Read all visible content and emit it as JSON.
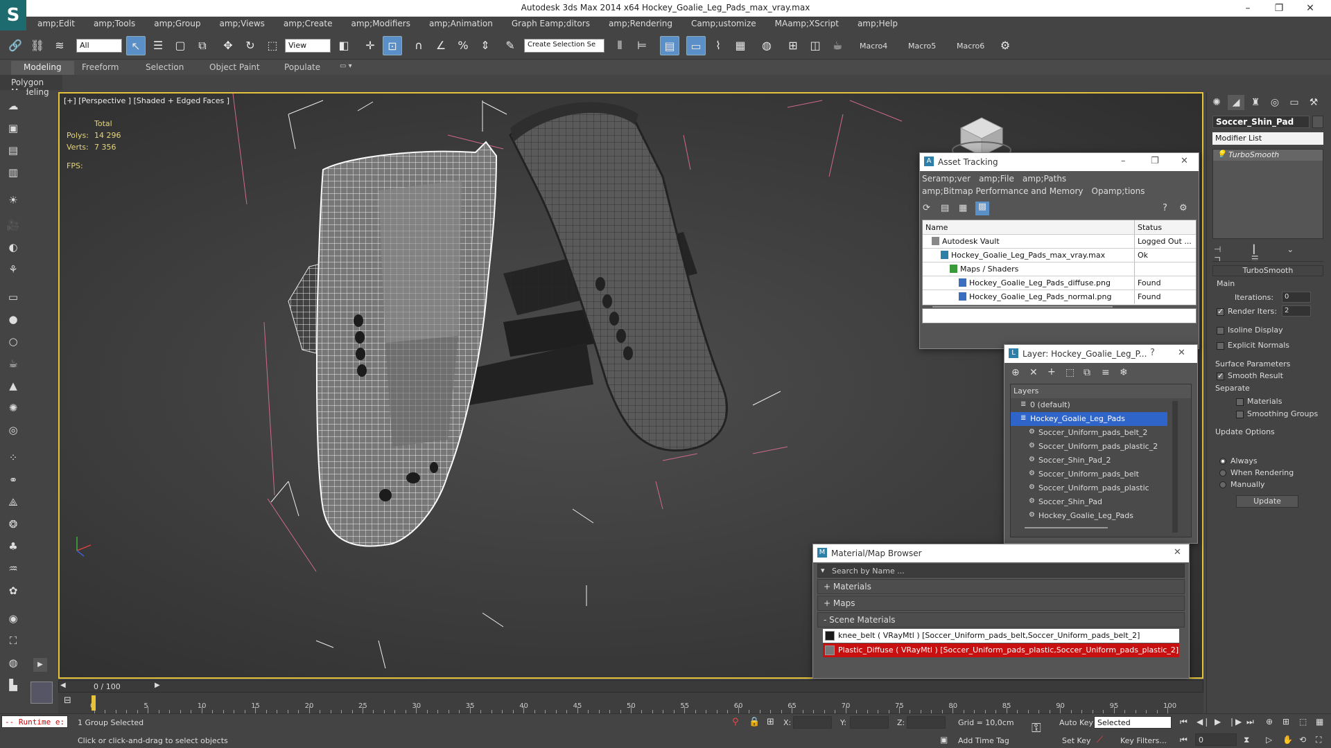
{
  "window": {
    "title": "Autodesk 3ds Max  2014 x64    Hockey_Goalie_Leg_Pads_max_vray.max",
    "controls": [
      "–",
      "❐",
      "✕"
    ]
  },
  "menu": [
    "amp;Edit",
    "amp;Tools",
    "amp;Group",
    "amp;Views",
    "amp;Create",
    "amp;Modifiers",
    "amp;Animation",
    "Graph Eamp;ditors",
    "amp;Rendering",
    "Camp;ustomize",
    "MAamp;XScript",
    "amp;Help"
  ],
  "toolbar": {
    "selection_filter": "All",
    "ref_coord": "View",
    "named_selection_placeholder": "Create Selection Se",
    "macros": [
      "Macro4",
      "Macro5",
      "Macro6"
    ]
  },
  "ribbon": {
    "tabs": [
      "Modeling",
      "Freeform",
      "Selection",
      "Object Paint",
      "Populate"
    ],
    "active_tab": "Modeling",
    "sub_label": "Polygon Modeling"
  },
  "viewport": {
    "label": "[+] [Perspective ] [Shaded + Edged Faces ]",
    "stats": {
      "total_label": "Total",
      "polys_label": "Polys:",
      "polys_value": "14 296",
      "verts_label": "Verts:",
      "verts_value": "7 356",
      "fps_label": "FPS:"
    }
  },
  "command_panel": {
    "object_name": "Soccer_Shin_Pad",
    "modifier_list": "Modifier List",
    "stack_item": "TurboSmooth",
    "rollout_title": "TurboSmooth",
    "main_label": "Main",
    "iterations_label": "Iterations:",
    "iterations_value": "0",
    "render_iters_label": "Render Iters:",
    "render_iters_value": "2",
    "render_iters_checked": true,
    "isoline_label": "Isoline Display",
    "explicit_normals_label": "Explicit Normals",
    "surface_params_label": "Surface Parameters",
    "smooth_result_label": "Smooth Result",
    "separate_label": "Separate",
    "materials_label": "Materials",
    "smoothing_groups_label": "Smoothing Groups",
    "update_options_label": "Update Options",
    "always_label": "Always",
    "when_rendering_label": "When Rendering",
    "manually_label": "Manually",
    "update_button": "Update"
  },
  "asset_tracking": {
    "title": "Asset Tracking",
    "menu1": [
      "Seramp;ver",
      "amp;File",
      "amp;Paths"
    ],
    "menu2": [
      "amp;Bitmap Performance and Memory",
      "Opamp;tions"
    ],
    "col_name": "Name",
    "col_status": "Status",
    "rows": [
      {
        "name": "Autodesk Vault",
        "status": "Logged Out ...",
        "indent": 1,
        "icon": "vault-icon"
      },
      {
        "name": "Hockey_Goalie_Leg_Pads_max_vray.max",
        "status": "Ok",
        "indent": 2,
        "icon": "max-file-icon"
      },
      {
        "name": "Maps / Shaders",
        "status": "",
        "indent": 3,
        "icon": "maps-icon"
      },
      {
        "name": "Hockey_Goalie_Leg_Pads_diffuse.png",
        "status": "Found",
        "indent": 4,
        "icon": "image-file-icon"
      },
      {
        "name": "Hockey_Goalie_Leg_Pads_normal.png",
        "status": "Found",
        "indent": 4,
        "icon": "image-file-icon"
      }
    ]
  },
  "layer_window": {
    "title": "Layer: Hockey_Goalie_Leg_P...",
    "help": "?",
    "header": "Layers",
    "rows": [
      {
        "name": "0 (default)",
        "indent": 1,
        "selected": false
      },
      {
        "name": "Hockey_Goalie_Leg_Pads",
        "indent": 1,
        "selected": true
      },
      {
        "name": "Soccer_Uniform_pads_belt_2",
        "indent": 2,
        "selected": false
      },
      {
        "name": "Soccer_Uniform_pads_plastic_2",
        "indent": 2,
        "selected": false
      },
      {
        "name": "Soccer_Shin_Pad_2",
        "indent": 2,
        "selected": false
      },
      {
        "name": "Soccer_Uniform_pads_belt",
        "indent": 2,
        "selected": false
      },
      {
        "name": "Soccer_Uniform_pads_plastic",
        "indent": 2,
        "selected": false
      },
      {
        "name": "Soccer_Shin_Pad",
        "indent": 2,
        "selected": false
      },
      {
        "name": "Hockey_Goalie_Leg_Pads",
        "indent": 2,
        "selected": false
      }
    ]
  },
  "material_browser": {
    "title": "Material/Map Browser",
    "search_placeholder": "Search by Name ...",
    "groups": [
      "+ Materials",
      "+ Maps",
      "- Scene Materials"
    ],
    "materials": [
      {
        "label": "knee_belt  ( VRayMtl ) [Soccer_Uniform_pads_belt,Soccer_Uniform_pads_belt_2]",
        "swatch": "#1a1a1a",
        "bg": "#ffffff",
        "color": "#111111"
      },
      {
        "label": "Plastic_Diffuse ( VRayMtl ) [Soccer_Uniform_pads_plastic,Soccer_Uniform_pads_plastic_2]",
        "swatch": "#777777",
        "bg": "#c81010",
        "color": "#ffffff"
      }
    ]
  },
  "timeline": {
    "frame_label": "0 / 100",
    "ticks": [
      0,
      5,
      10,
      15,
      20,
      25,
      30,
      35,
      40,
      45,
      50,
      55,
      60,
      65,
      70,
      75,
      80,
      85,
      90,
      95,
      100
    ]
  },
  "status": {
    "runtime": "-- Runtime e:",
    "selection": "1 Group Selected",
    "prompt": "Click or click-and-drag to select objects",
    "x_label": "X:",
    "y_label": "Y:",
    "z_label": "Z:",
    "grid": "Grid = 10,0cm",
    "add_time_tag": "Add Time Tag",
    "auto_key": "Auto Key",
    "set_key": "Set Key",
    "key_mode": "Selected",
    "key_filters": "Key Filters...",
    "frame": "0"
  },
  "colors": {
    "viewport_border": "#e6c43a",
    "selection_blue": "#2f64c8",
    "stats_yellow": "#e6d67a",
    "scene_mat_red": "#c81010"
  }
}
